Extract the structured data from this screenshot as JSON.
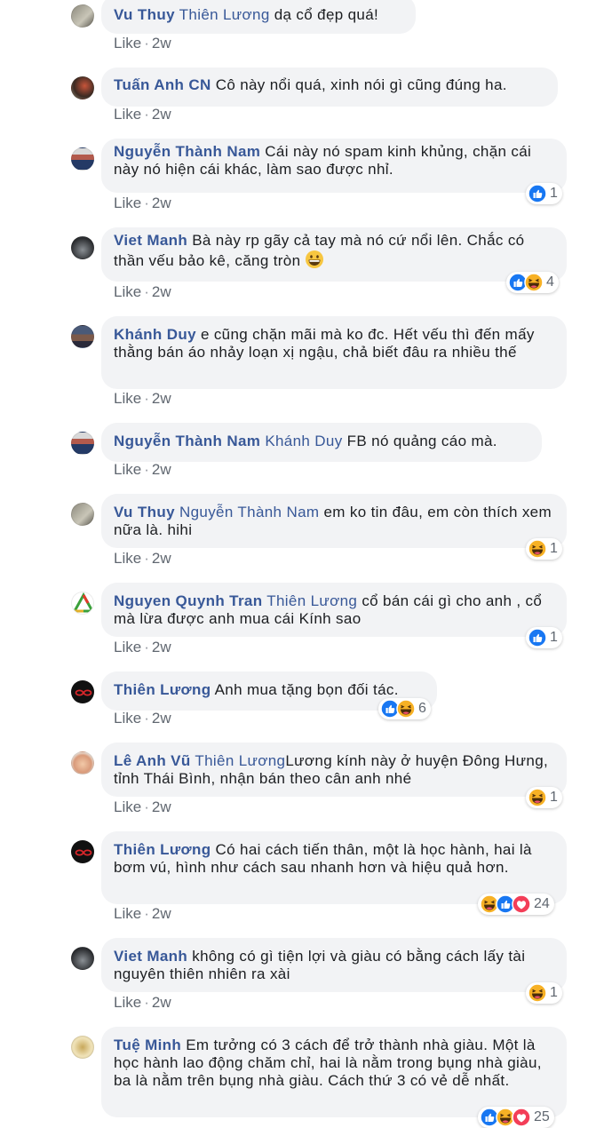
{
  "comments": [
    {
      "author": "Vu Thuy",
      "mention": "Thiên Lương",
      "text": " dạ cổ đẹp quá!",
      "like": "Like",
      "time": "2w",
      "avatar": "avatar-gray-pic"
    },
    {
      "author": "Tuấn Anh CN",
      "mention": "",
      "text": " Cô này nổi quá, xinh nói gì cũng đúng ha.",
      "like": "Like",
      "time": "2w",
      "avatar": "avatar-photo"
    },
    {
      "author": "Nguyễn Thành Nam",
      "mention": "",
      "text": " Cái này nó spam kinh khủng, chặn cái này nó hiện cái khác, làm sao được nhỉ.",
      "like": "Like",
      "time": "2w",
      "reaction_count": "1",
      "reaction_icons": [
        "like-reaction-icon"
      ]
    },
    {
      "author": "Viet Manh",
      "mention": "",
      "text": " Bà này rp gãy cả tay mà nó cứ nổi lên. Chắc có thần vếu bảo kê, căng tròn ",
      "like": "Like",
      "time": "2w",
      "reaction_count": "4",
      "reaction_icons": [
        "like-reaction-icon",
        "haha-reaction-icon"
      ],
      "inline_emoji": "grinning-emoji-icon"
    },
    {
      "author": "Khánh Duy",
      "mention": "",
      "text": " e cũng chặn mãi mà ko đc. Hết vếu thì đến mấy thằng bán áo nhảy loạn xị ngậu, chả biết đâu ra nhiều thế",
      "like": "Like",
      "time": "2w"
    },
    {
      "author": "Nguyễn Thành Nam",
      "mention": "Khánh Duy",
      "text": " FB nó quảng cáo mà.",
      "like": "Like",
      "time": "2w"
    },
    {
      "author": "Vu Thuy",
      "mention": "Nguyễn Thành Nam",
      "text": " em ko tin đâu, em còn thích xem nữa là. hihi",
      "like": "Like",
      "time": "2w",
      "reaction_count": "1",
      "reaction_icons": [
        "haha-reaction-icon"
      ]
    },
    {
      "author": "Nguyen Quynh Tran",
      "mention": "Thiên Lương",
      "text": " cổ bán cái gì cho anh , cổ mà lừa được anh mua cái Kính sao",
      "like": "Like",
      "time": "2w",
      "reaction_count": "1",
      "reaction_icons": [
        "like-reaction-icon"
      ]
    },
    {
      "author": "Thiên Lương",
      "mention": "",
      "text": " Anh mua tặng bọn đối tác.",
      "like": "Like",
      "time": "2w",
      "reaction_count": "6",
      "reaction_icons": [
        "like-reaction-icon",
        "haha-reaction-icon"
      ]
    },
    {
      "author": "Lê Anh Vũ",
      "mention": "Thiên Lương",
      "text": "Lương kính này ở huyện Đông Hưng, tỉnh Thái Bình, nhận bán theo cân anh nhé",
      "like": "Like",
      "time": "2w",
      "reaction_count": "1",
      "reaction_icons": [
        "haha-reaction-icon"
      ]
    },
    {
      "author": "Thiên Lương",
      "mention": "",
      "text": " Có hai cách tiến thân, một là học hành, hai là bơm vú, hình như cách sau nhanh hơn và hiệu quả hơn.",
      "like": "Like",
      "time": "2w",
      "reaction_count": "24",
      "reaction_icons": [
        "haha-reaction-icon",
        "like-reaction-icon",
        "love-reaction-icon"
      ]
    },
    {
      "author": "Viet Manh",
      "mention": "",
      "text": " không có gì tiện lợi và giàu có bằng cách lấy tài nguyên thiên nhiên ra xài",
      "like": "Like",
      "time": "2w",
      "reaction_count": "1",
      "reaction_icons": [
        "haha-reaction-icon"
      ]
    },
    {
      "author": "Tuệ Minh",
      "mention": "",
      "text": " Em tưởng có 3 cách để trở thành nhà giàu. Một là học hành lao động chăm chỉ, hai là nằm trong bụng nhà giàu, ba là nằm trên bụng nhà giàu. Cách thứ 3 có vẻ dễ nhất.",
      "like": "Like",
      "time": "2w",
      "reaction_count": "25",
      "reaction_icons": [
        "like-reaction-icon",
        "haha-reaction-icon",
        "love-reaction-icon"
      ]
    }
  ],
  "colors": {
    "link": "#385898",
    "bubble": "#f2f3f5",
    "meta": "#606770",
    "like_blue": "#1877f2",
    "love_red": "#f33e58",
    "haha_yellow": "#f7b125"
  }
}
